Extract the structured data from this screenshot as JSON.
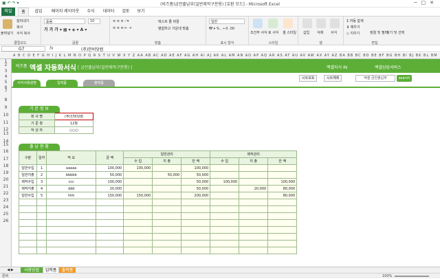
{
  "window": {
    "title": "(비즈폼)금전출납부(일반제작구분용) [호환 모드] - Microsoft Excel"
  },
  "ribbon_tabs": [
    "파일",
    "홈",
    "삽입",
    "페이지 레이아웃",
    "수식",
    "데이터",
    "검토",
    "보기"
  ],
  "ribbon": {
    "paste": "붙여넣기",
    "cut": "잘라내기",
    "copy": "복사",
    "format_painter": "서식 복사",
    "clipboard": "클립보드",
    "font_name": "돋움",
    "font_size": "10",
    "font_group": "글꼴",
    "wrap_text": "텍스트 줄 바꿈",
    "merge_center": "병합하고 가운데 맞춤",
    "align_group": "맞춤",
    "number_format": "일반",
    "number_group": "표시 형식",
    "conditional": "조건부 서식",
    "table_format": "표 서식",
    "cell_styles": "셀 스타일",
    "style_group": "스타일",
    "insert": "삽입",
    "delete": "삭제",
    "format": "서식",
    "cells_group": "셀",
    "autosum": "자동 합계",
    "fill": "채우기",
    "clear": "지우기",
    "sort_filter": "정렬 및 필터",
    "find_select": "찾기 및 선택",
    "edit_group": "편집"
  },
  "formula_bar": {
    "name_box": "G7",
    "fx": "fx",
    "value": "(주)인비닷컴"
  },
  "column_letters": "A B C D E F G H I J K L M N O P Q R S T U V W X Y Z AA AB AC AD AE AF AG AH AI AJ AK AL AM AN AO AP AQ AR AS AT AU AV AW AX AY AZ BA BB BC BD BE BF BG BH BI BJ BK BL BM",
  "row_numbers": [
    "1",
    "2",
    "3",
    "4",
    "5",
    "6",
    "7",
    "8",
    "9",
    "10",
    "11",
    "12",
    "13",
    "14",
    "15",
    "16",
    "17",
    "18",
    "19",
    "20",
    "21",
    "22",
    "23",
    "24",
    "25",
    "26"
  ],
  "header": {
    "brand": "비즈폼",
    "title": "엑셀 자동화서식",
    "subtitle": "[ 금전출납부(일반제작구분용) ]",
    "link1": "엑셀자식 IN",
    "link2": "엑셀상담서비스"
  },
  "nav": {
    "form_tab": "서식사용설명",
    "input_tab": "입력폼",
    "output_tab": "출력폼"
  },
  "toolbar": {
    "sheet_protect": "시트보호",
    "sheet_unprotect": "시트해제",
    "search_placeholder": "엑셀 금전출납부",
    "search_button": "search"
  },
  "basic_info": {
    "section_title": "기 본 정 보",
    "rows": [
      {
        "label": "회 사 명",
        "value": "(주)인비닷컴"
      },
      {
        "label": "기 준 월",
        "value": "12월"
      },
      {
        "label": "작 성 자",
        "value": "○○○"
      }
    ]
  },
  "ledger": {
    "section_title": "출 납 현 황",
    "headers": {
      "category": "구분",
      "day": "일자",
      "summary": "적 요",
      "amount": "금 액",
      "general": "일반관리",
      "production": "제작관리",
      "income": "수 입",
      "expense": "지 출",
      "balance": "잔 액"
    },
    "rows": [
      {
        "cat": "일반수입",
        "day": "1",
        "summary": "aaaaa",
        "amount": "100,000",
        "g_in": "100,000",
        "g_out": "",
        "g_bal": "100,000",
        "p_in": "",
        "p_out": "",
        "p_bal": ""
      },
      {
        "cat": "일반지출",
        "day": "2",
        "summary": "bbbbb",
        "amount": "50,000",
        "g_in": "",
        "g_out": "50,000",
        "g_bal": "50,000",
        "p_in": "",
        "p_out": "",
        "p_bal": ""
      },
      {
        "cat": "제작수입",
        "day": "3",
        "summary": "ccc",
        "amount": "100,000",
        "g_in": "",
        "g_out": "",
        "g_bal": "50,000",
        "p_in": "100,000",
        "p_out": "",
        "p_bal": "100,000"
      },
      {
        "cat": "제작지출",
        "day": "4",
        "summary": "ddd",
        "amount": "20,000",
        "g_in": "",
        "g_out": "",
        "g_bal": "50,000",
        "p_in": "",
        "p_out": "20,000",
        "p_bal": "80,000"
      },
      {
        "cat": "일반수입",
        "day": "5",
        "summary": "hhh",
        "amount": "150,000",
        "g_in": "150,000",
        "g_out": "",
        "g_bal": "200,000",
        "p_in": "",
        "p_out": "",
        "p_bal": "80,000"
      }
    ],
    "empty_rows": 8
  },
  "sheet_tabs": [
    "사용방법",
    "입력폼",
    "출력폼"
  ],
  "status": {
    "left": "준비",
    "zoom": "100%"
  }
}
